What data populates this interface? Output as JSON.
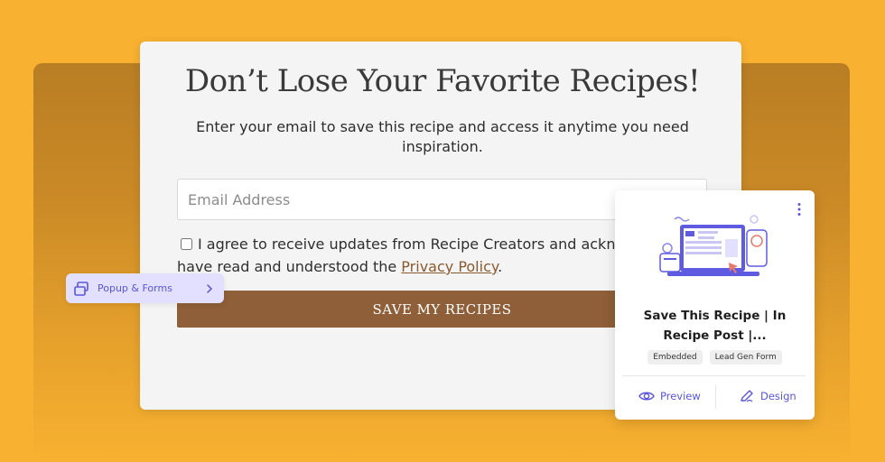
{
  "modal": {
    "title": "Don’t Lose Your Favorite Recipes!",
    "subtitle": "Enter your email to save this recipe and access it anytime you need inspiration.",
    "email_placeholder": "Email Address",
    "consent_text": "I agree to receive updates from Recipe Creators and ackno",
    "consent_text_line2": "have read and understood the",
    "privacy_link": "Privacy Policy",
    "consent_end": ".",
    "button_label": "SAVE MY RECIPES"
  },
  "pill": {
    "label": "Popup & Forms",
    "icon": "popup-window-icon"
  },
  "card": {
    "title": "Save This Recipe | In Recipe Post |...",
    "tags": [
      "Embedded",
      "Lead Gen Form"
    ],
    "preview_label": "Preview",
    "design_label": "Design",
    "menu_icon": "kebab-menu-icon"
  },
  "colors": {
    "background": "#F8B130",
    "button": "#8E5F38",
    "accent": "#5A55D8"
  }
}
